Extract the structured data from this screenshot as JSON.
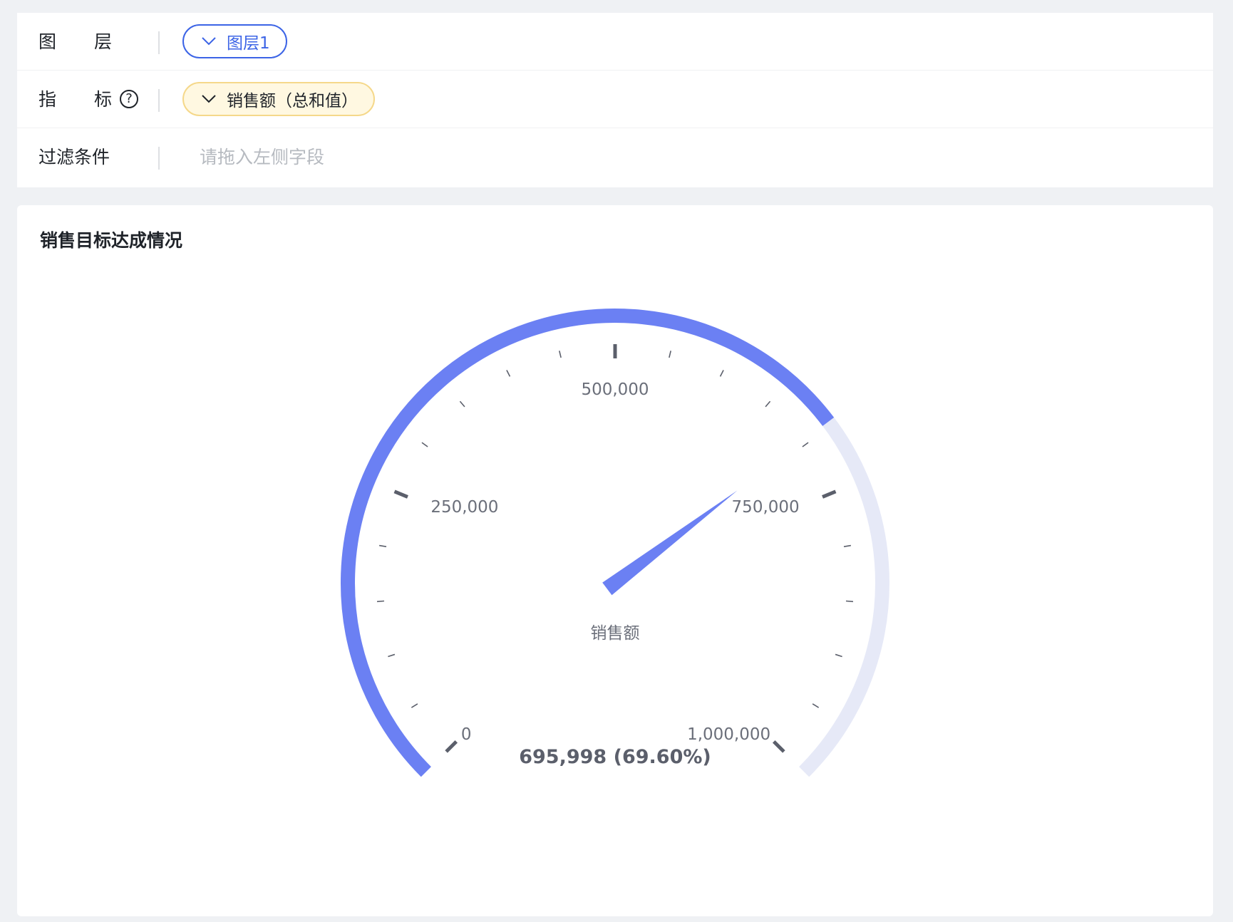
{
  "config": {
    "layer": {
      "label_char1": "图",
      "label_char2": "层",
      "value": "图层1"
    },
    "metric": {
      "label_char1": "指",
      "label_char2": "标",
      "help_symbol": "?",
      "value": "销售额（总和值）"
    },
    "filter": {
      "label": "过滤条件",
      "placeholder": "请拖入左侧字段"
    }
  },
  "chart_data": {
    "type": "gauge",
    "title": "销售目标达成情况",
    "series_name": "销售额",
    "value": 695998,
    "min": 0,
    "max": 1000000,
    "value_label": "695,998 (69.60%)",
    "major_ticks": [
      0,
      250000,
      500000,
      750000,
      1000000
    ],
    "major_tick_labels": [
      "0",
      "250,000",
      "500,000",
      "750,000",
      "1,000,000"
    ],
    "minor_ticks_per_interval": 4,
    "colors": {
      "progress": "#6b80f3",
      "track": "#e6e9f7",
      "pointer": "#6b80f3",
      "tick": "#5b5f6b",
      "label": "#6b6f7a"
    }
  }
}
